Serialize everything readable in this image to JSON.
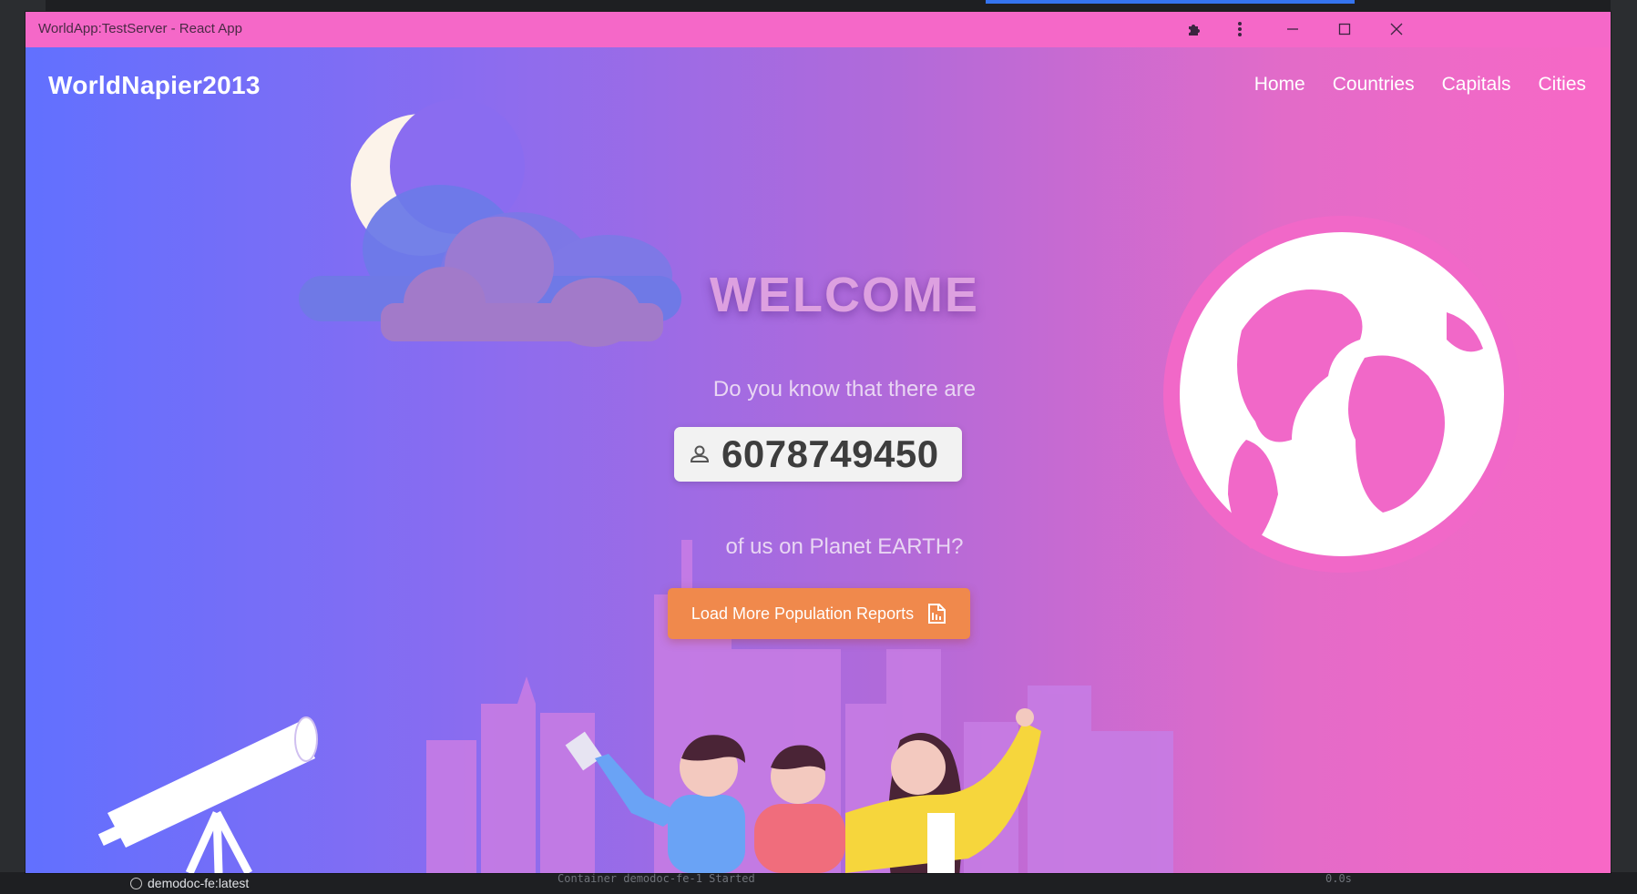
{
  "window": {
    "title": "WorldApp:TestServer - React App",
    "icons": [
      "puzzle-icon",
      "more-vertical-icon",
      "minimize-icon",
      "maximize-icon",
      "close-icon"
    ]
  },
  "navbar": {
    "brand": "WorldNapier2013",
    "links": [
      {
        "label": "Home"
      },
      {
        "label": "Countries"
      },
      {
        "label": "Capitals"
      },
      {
        "label": "Cities"
      }
    ]
  },
  "hero": {
    "heading": "WELCOME",
    "question": "Do you know that there are",
    "population": "6078749450",
    "planet_text": "of us on Planet EARTH?",
    "button_label": "Load More Population Reports"
  },
  "ide_background": {
    "status_item": "demodoc-fe:latest",
    "faint_text": "Container demodoc-fe-1  Started",
    "faint_time": "0.0s"
  },
  "colors": {
    "gradient_start": "#6170ff",
    "gradient_end": "#f868c6",
    "titlebar": "#f568c8",
    "button": "#f0894c",
    "globe_ring": "#f168c8"
  }
}
